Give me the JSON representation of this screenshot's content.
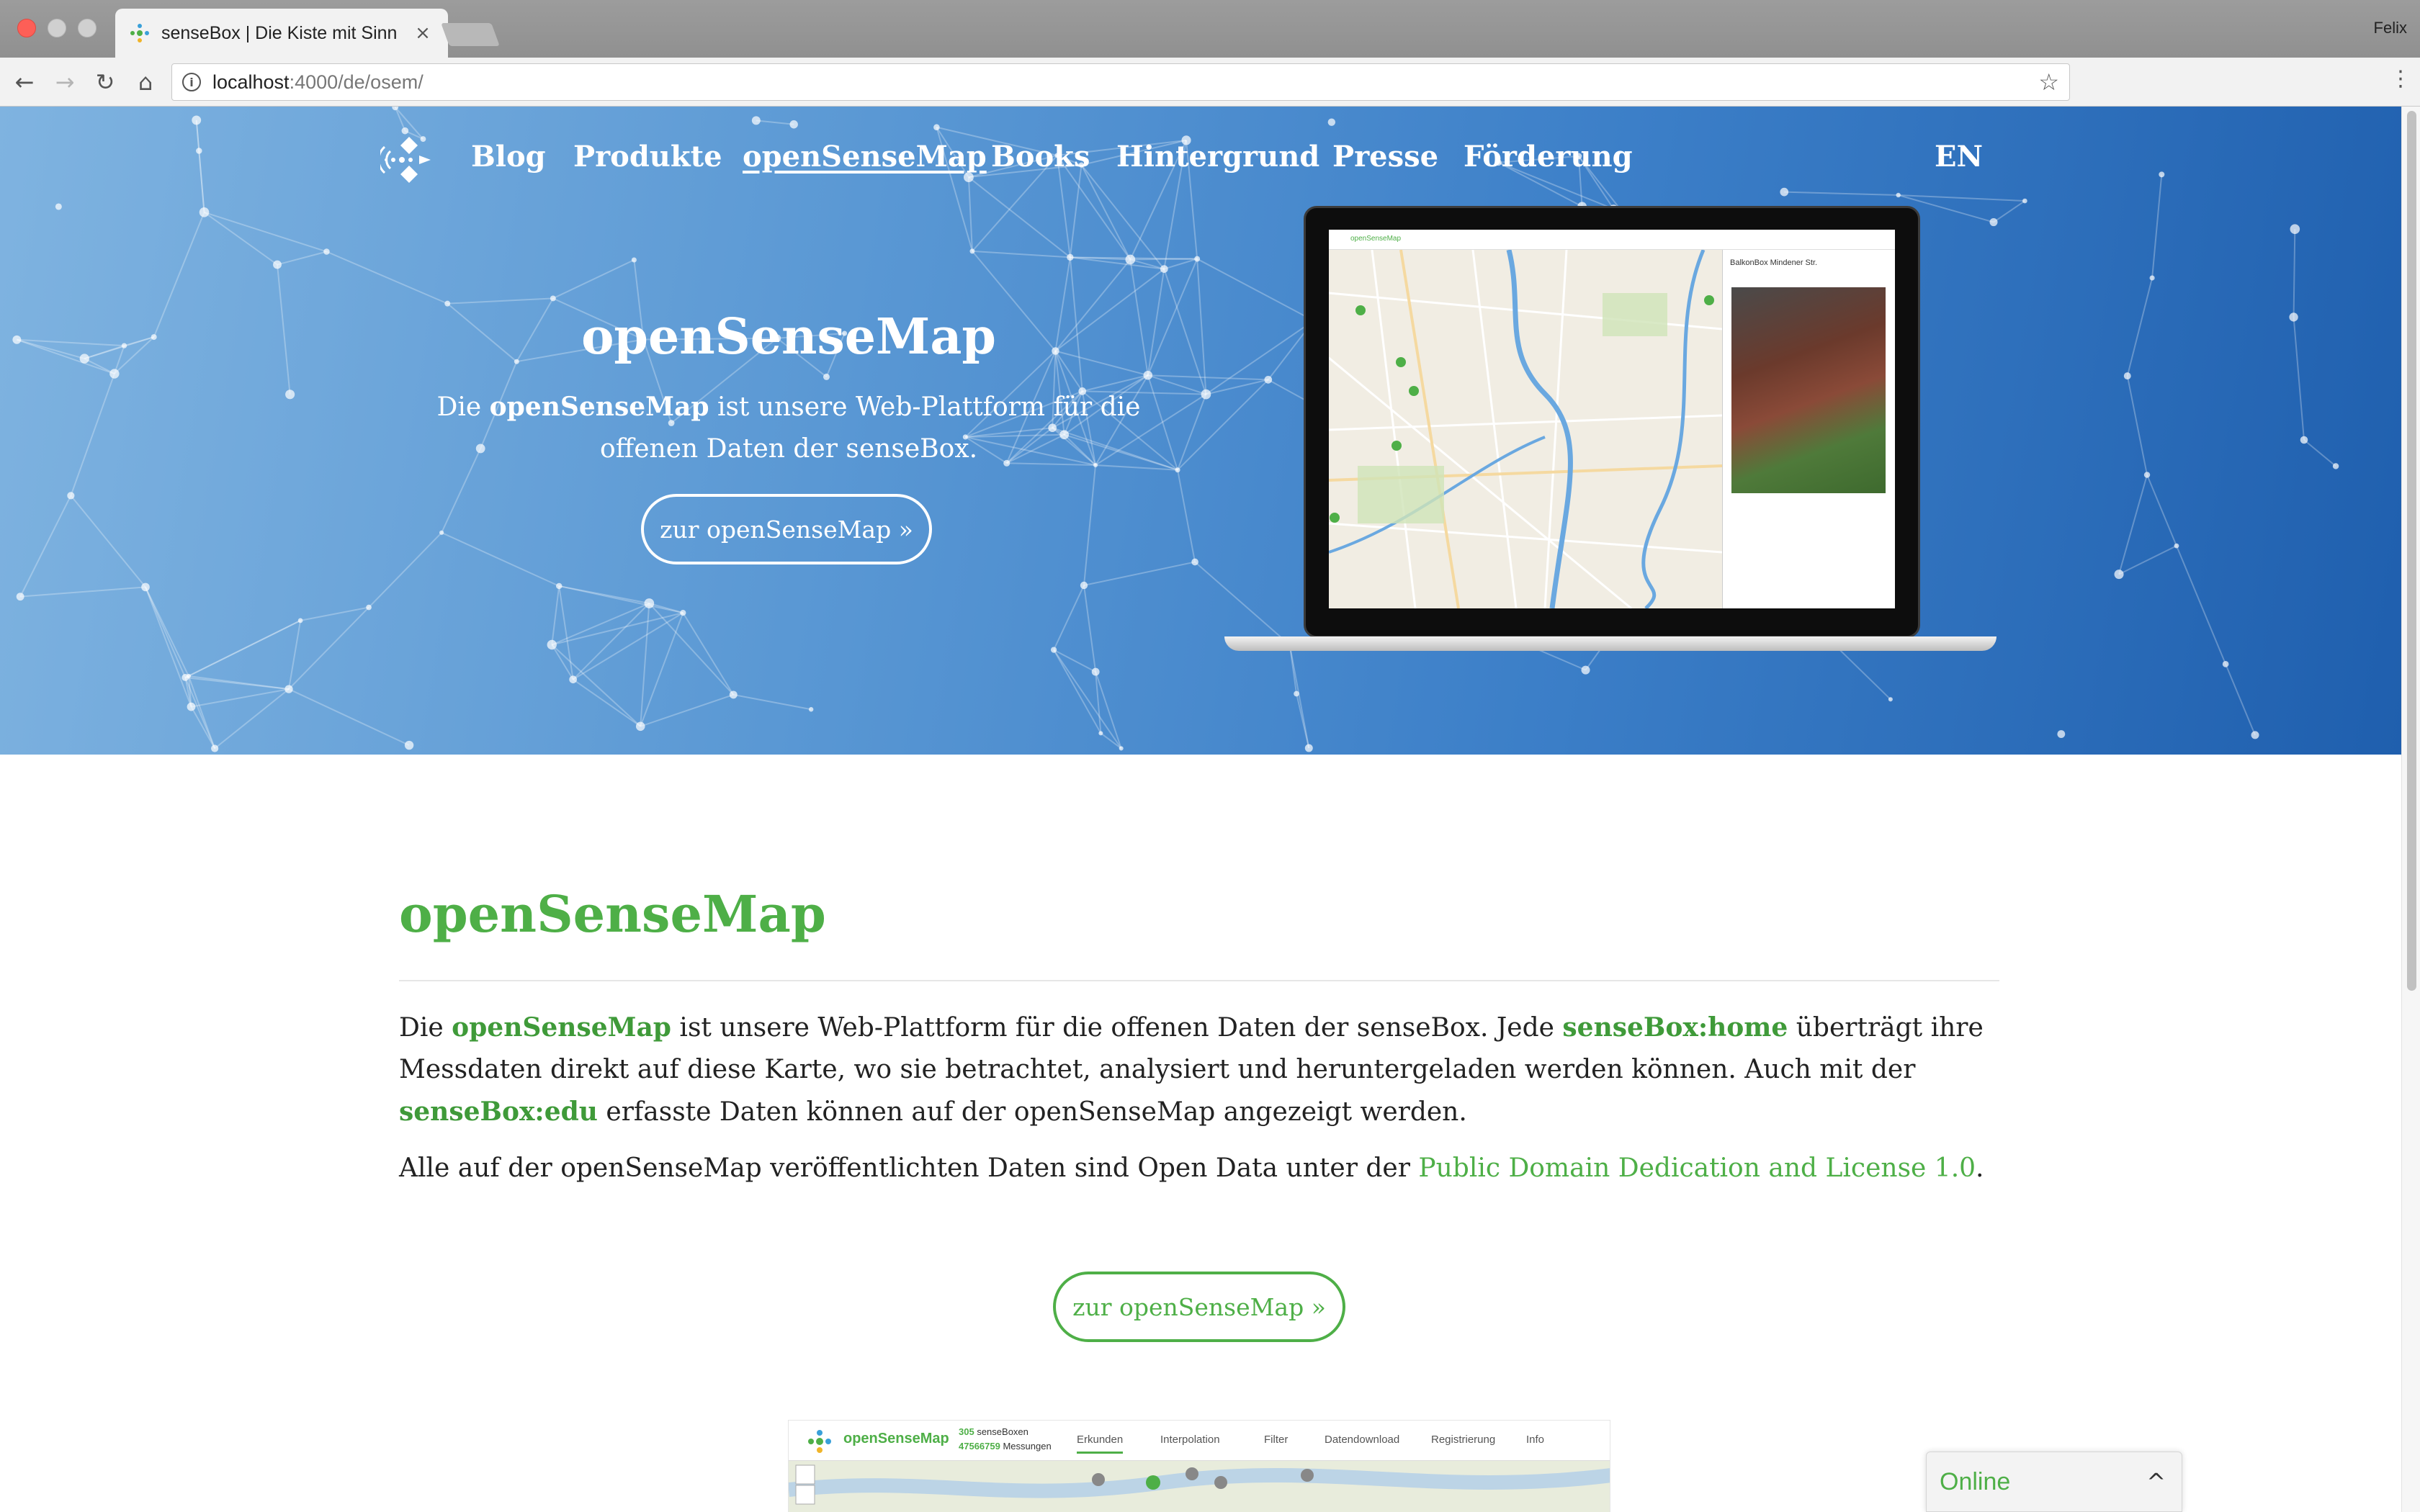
{
  "browser": {
    "tab_title": "senseBox | Die Kiste mit Sinn",
    "tab_close": "×",
    "profile_name": "Felix",
    "url_host": "localhost",
    "url_rest": ":4000/de/osem/",
    "icons": {
      "back": "arrow-left",
      "forward": "arrow-right",
      "reload": "reload",
      "home": "home",
      "info": "info",
      "bookmark": "star",
      "menu": "vertical-dots"
    }
  },
  "site": {
    "nav": {
      "items": [
        {
          "label": "Blog"
        },
        {
          "label": "Produkte"
        },
        {
          "label": "openSenseMap",
          "active": true
        },
        {
          "label": "Books"
        },
        {
          "label": "Hintergrund"
        },
        {
          "label": "Presse"
        },
        {
          "label": "Förderung"
        }
      ],
      "language": "EN"
    },
    "hero": {
      "title": "openSenseMap",
      "text_pre": "Die ",
      "text_bold": "openSenseMap",
      "text_post": " ist unsere Web-Plattform für die offenen Daten der senseBox.",
      "button": "zur openSenseMap »"
    },
    "laptop": {
      "header_brand": "openSenseMap",
      "panel_title": "BalkonBox Mindener Str."
    },
    "content": {
      "title": "openSenseMap",
      "p1": [
        {
          "t": "Die "
        },
        {
          "t": "openSenseMap",
          "link": true
        },
        {
          "t": " ist unsere Web-Plattform für die offenen Daten der senseBox. Jede "
        },
        {
          "t": "senseBox:home",
          "link": true
        },
        {
          "t": " überträgt ihre Messdaten direkt auf diese Karte, wo sie betrachtet, analysiert und heruntergeladen werden können. Auch mit der "
        },
        {
          "t": "senseBox:edu",
          "link": true
        },
        {
          "t": " erfasste Daten können auf der openSenseMap angezeigt werden."
        }
      ],
      "p2_pre": "Alle auf der openSenseMap veröffentlichten Daten sind Open Data unter der ",
      "p2_link": "Public Domain Dedication and License 1.0",
      "p2_post": ".",
      "button": "zur openSenseMap »"
    },
    "screenshot": {
      "brand": "openSenseMap",
      "boxes_count": "305",
      "boxes_label": "senseBoxen",
      "measurements_count": "47566759",
      "measurements_label": "Messungen",
      "tabs": [
        "Erkunden",
        "Interpolation",
        "Filter",
        "Datendownload",
        "Registrierung",
        "Info"
      ]
    },
    "online_widget": {
      "label": "Online",
      "chevron": "^"
    }
  },
  "colors": {
    "brand_green": "#4eaf47",
    "hero_blue_dark": "#1f5fae",
    "hero_blue_light": "#7fb3e0"
  }
}
